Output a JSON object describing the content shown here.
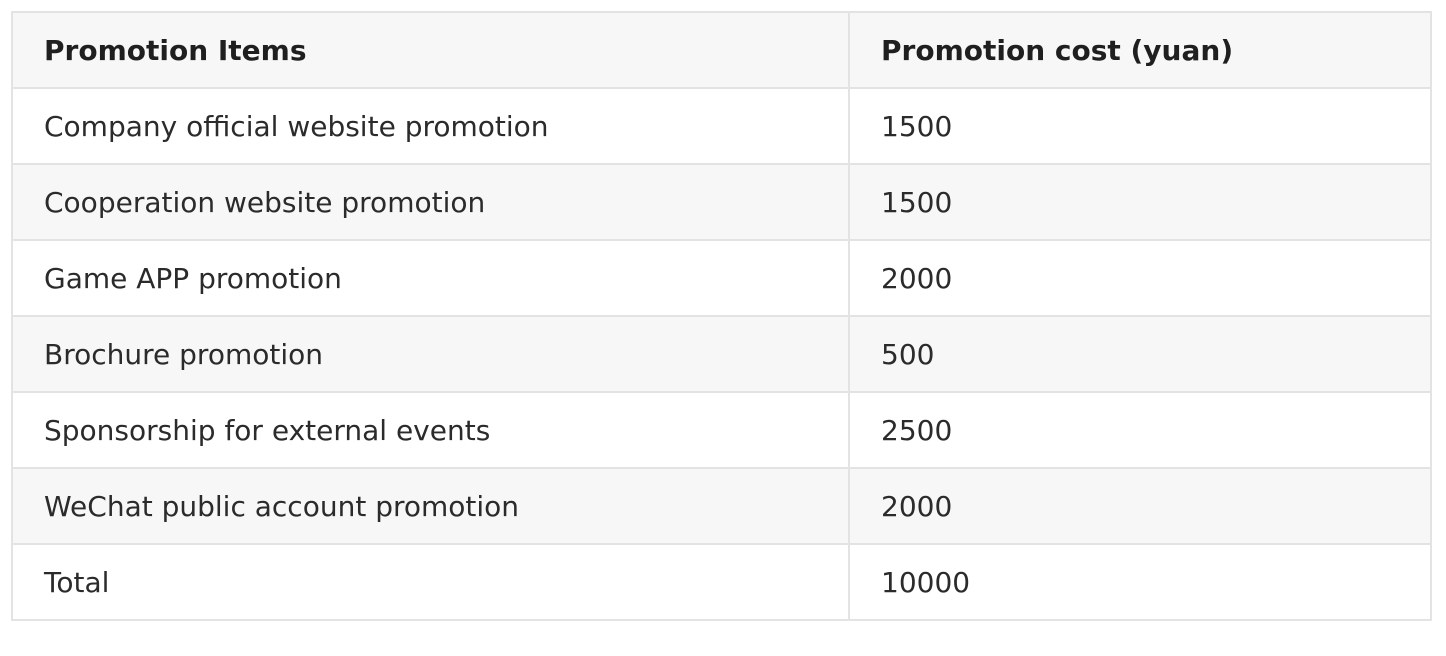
{
  "table": {
    "headers": [
      "Promotion Items",
      "Promotion cost (yuan)"
    ],
    "rows": [
      [
        "Company official website promotion",
        "1500"
      ],
      [
        "Cooperation website promotion",
        "1500"
      ],
      [
        "Game APP promotion",
        "2000"
      ],
      [
        "Brochure promotion",
        "500"
      ],
      [
        "Sponsorship for external events",
        "2500"
      ],
      [
        "WeChat public account promotion",
        "2000"
      ],
      [
        "Total",
        "10000"
      ]
    ]
  },
  "colors": {
    "border": "#e3e3e3",
    "header_bg": "#f7f7f7",
    "row_alt_bg": "#f7f7f7",
    "row_bg": "#ffffff",
    "text": "#2b2b2b"
  }
}
